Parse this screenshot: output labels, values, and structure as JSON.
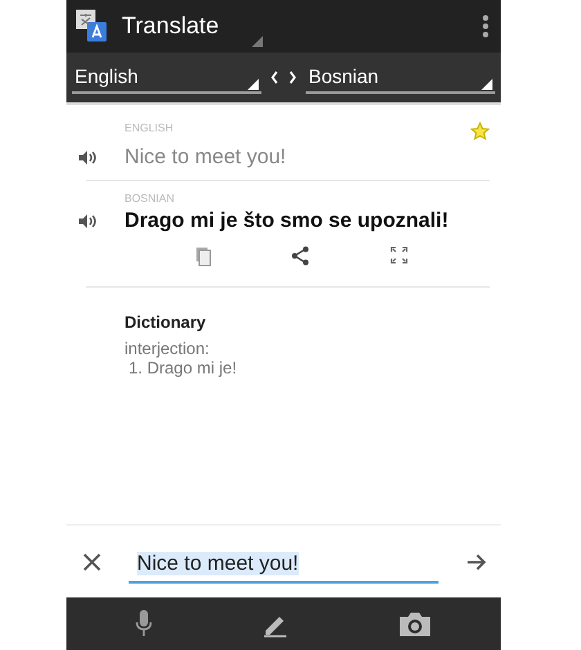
{
  "app_bar": {
    "title": "Translate"
  },
  "languages": {
    "source": "English",
    "target": "Bosnian"
  },
  "source": {
    "label": "ENGLISH",
    "text": "Nice to meet you!",
    "starred": true
  },
  "translation": {
    "label": "BOSNIAN",
    "text": "Drago mi je što smo se upoznali!"
  },
  "dictionary": {
    "title": "Dictionary",
    "part_of_speech": "interjection:",
    "entries": [
      "1. Drago mi je!"
    ]
  },
  "input": {
    "value": "Nice to meet you!",
    "highlighted": true
  }
}
